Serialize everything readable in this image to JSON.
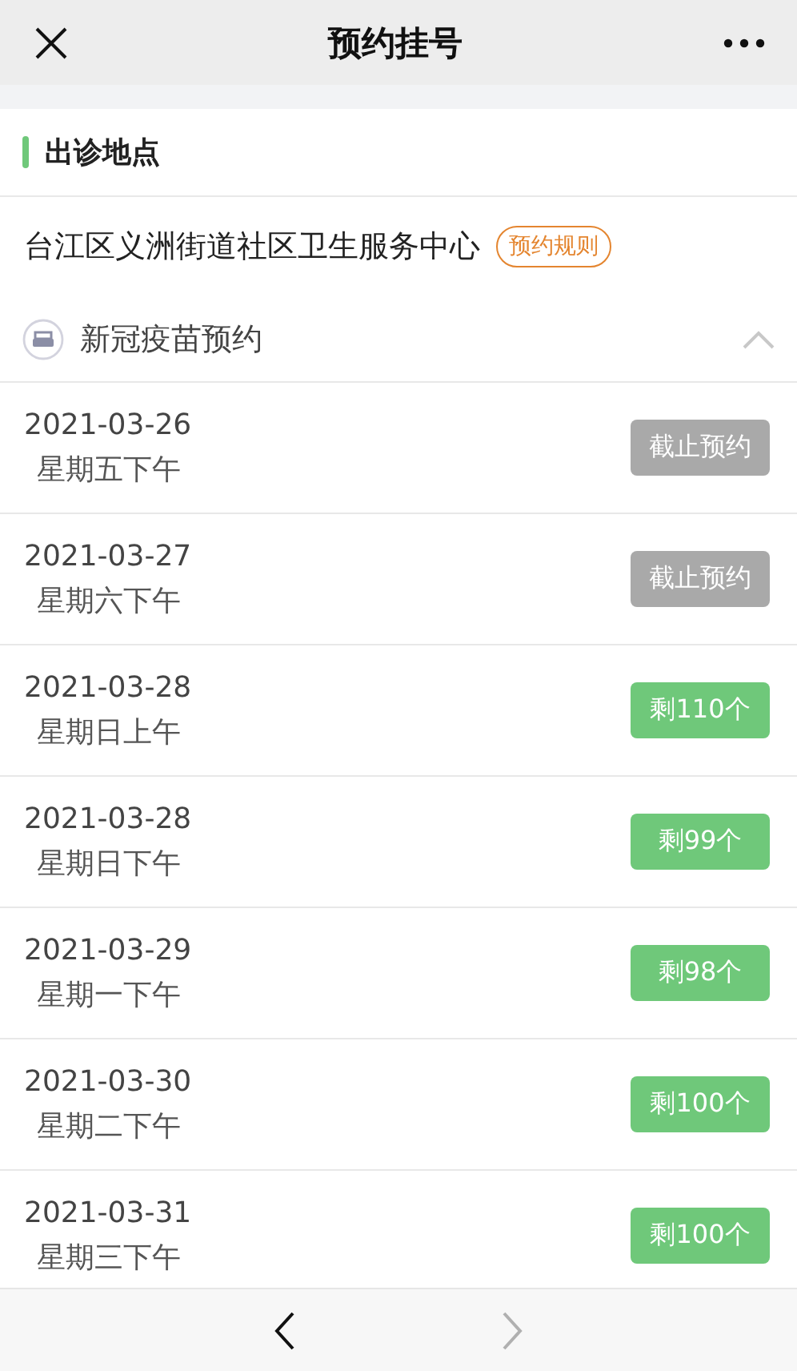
{
  "header": {
    "title": "预约挂号"
  },
  "section": {
    "title": "出诊地点"
  },
  "clinic": {
    "name": "台江区义洲街道社区卫生服务中心",
    "rules_link": "预约规则"
  },
  "category": {
    "title": "新冠疫苗预约",
    "expanded": true
  },
  "slots": [
    {
      "date": "2021-03-26",
      "session": "星期五下午",
      "disabled": true,
      "action": "截止预约"
    },
    {
      "date": "2021-03-27",
      "session": "星期六下午",
      "disabled": true,
      "action": "截止预约"
    },
    {
      "date": "2021-03-28",
      "session": "星期日上午",
      "disabled": false,
      "action": "剩110个"
    },
    {
      "date": "2021-03-28",
      "session": "星期日下午",
      "disabled": false,
      "action": "剩99个"
    },
    {
      "date": "2021-03-29",
      "session": "星期一下午",
      "disabled": false,
      "action": "剩98个"
    },
    {
      "date": "2021-03-30",
      "session": "星期二下午",
      "disabled": false,
      "action": "剩100个"
    },
    {
      "date": "2021-03-31",
      "session": "星期三下午",
      "disabled": false,
      "action": "剩100个"
    }
  ],
  "navigation": {
    "back_disabled": false,
    "forward_disabled": true
  }
}
